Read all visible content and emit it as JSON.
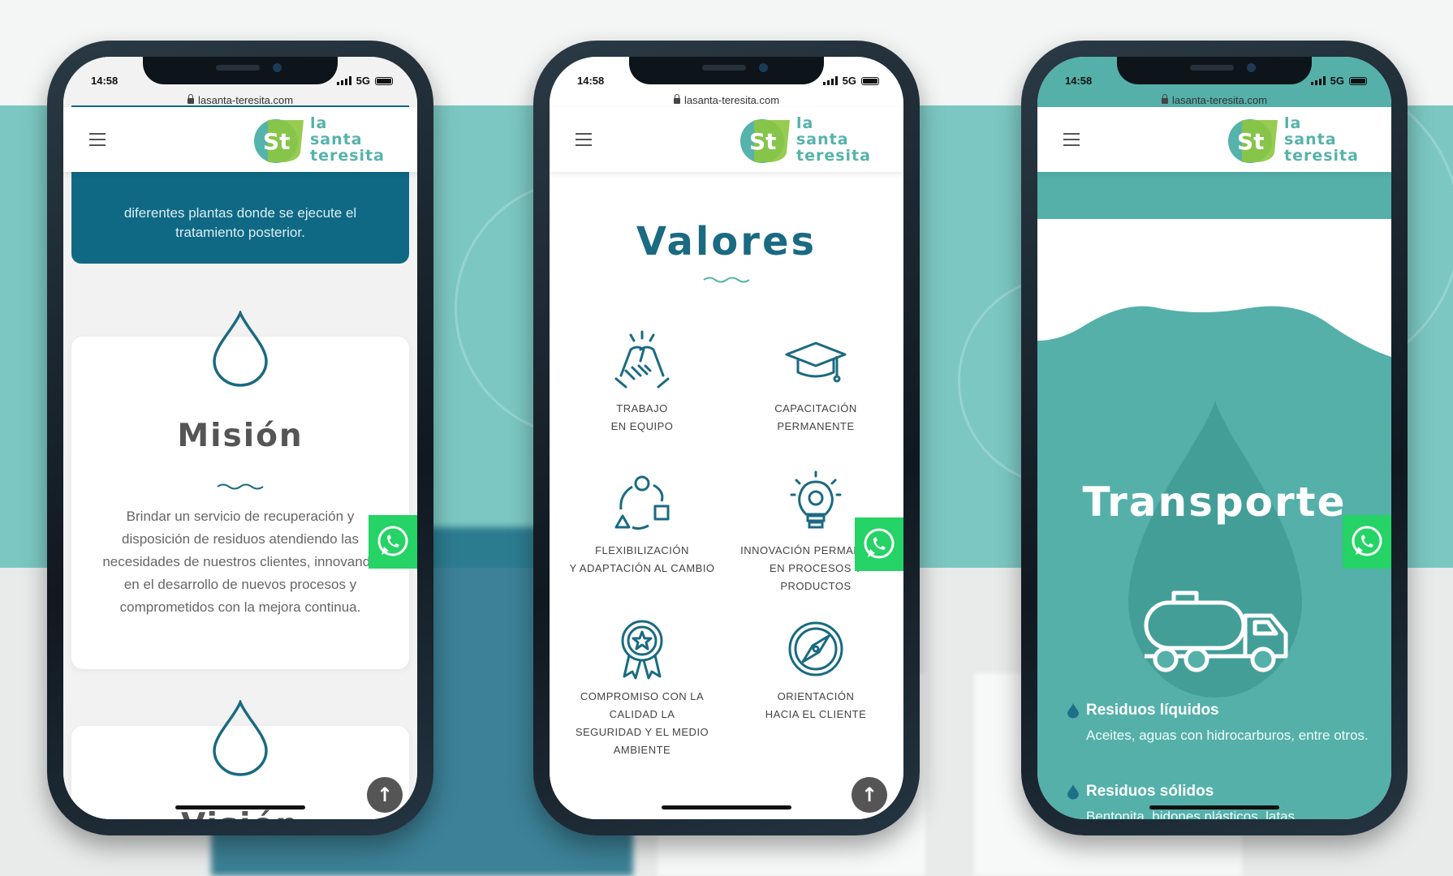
{
  "status_bar": {
    "time": "14:58",
    "network": "5G"
  },
  "browser": {
    "url": "lasanta-teresita.com"
  },
  "logo": {
    "mark": "LST",
    "line1": "la",
    "line2": "santa",
    "line3": "teresita"
  },
  "phone1": {
    "top_text_1": "diferentes plantas donde se ejecute el",
    "top_text_2": "tratamiento posterior.",
    "mission_title": "Misión",
    "mission_body": "Brindar un servicio de recuperación y disposición de residuos atendiendo las necesidades de nuestros clientes, innovando en el desarrollo de nuevos procesos y comprometidos con la mejora continua.",
    "vision_title": "Visión"
  },
  "phone2": {
    "title": "Valores",
    "values": [
      {
        "label": "TRABAJO\nEN EQUIPO",
        "icon": "handshake-icon"
      },
      {
        "label": "CAPACITACIÓN\nPERMANENTE",
        "icon": "graduation-cap-icon"
      },
      {
        "label": "FLEXIBILIZACIÓN\nY ADAPTACIÓN AL CAMBIO",
        "icon": "shapes-cycle-icon"
      },
      {
        "label": "INNOVACIÓN PERMANENTE\nEN PROCESOS Y PRODUCTOS",
        "icon": "lightbulb-gear-icon"
      },
      {
        "label": "COMPROMISO CON LA\nCALIDAD LA\nSEGURIDAD Y EL MEDIO\nAMBIENTE",
        "icon": "award-badge-icon"
      },
      {
        "label": "ORIENTACIÓN\nHACIA EL CLIENTE",
        "icon": "compass-icon"
      }
    ]
  },
  "phone3": {
    "title": "Transporte",
    "items": [
      {
        "title": "Residuos líquidos",
        "desc": "Aceites, aguas con hidrocarburos, entre otros."
      },
      {
        "title": "Residuos sólidos",
        "desc": "Bentonita, bidones plásticos, latas,"
      }
    ]
  },
  "colors": {
    "teal": "#55b0aa",
    "dark_teal": "#0f6985",
    "whatsapp": "#25d366"
  },
  "icons": {
    "whatsapp": "whatsapp-icon",
    "scroll_top": "arrow-up-icon",
    "menu": "hamburger-icon"
  }
}
